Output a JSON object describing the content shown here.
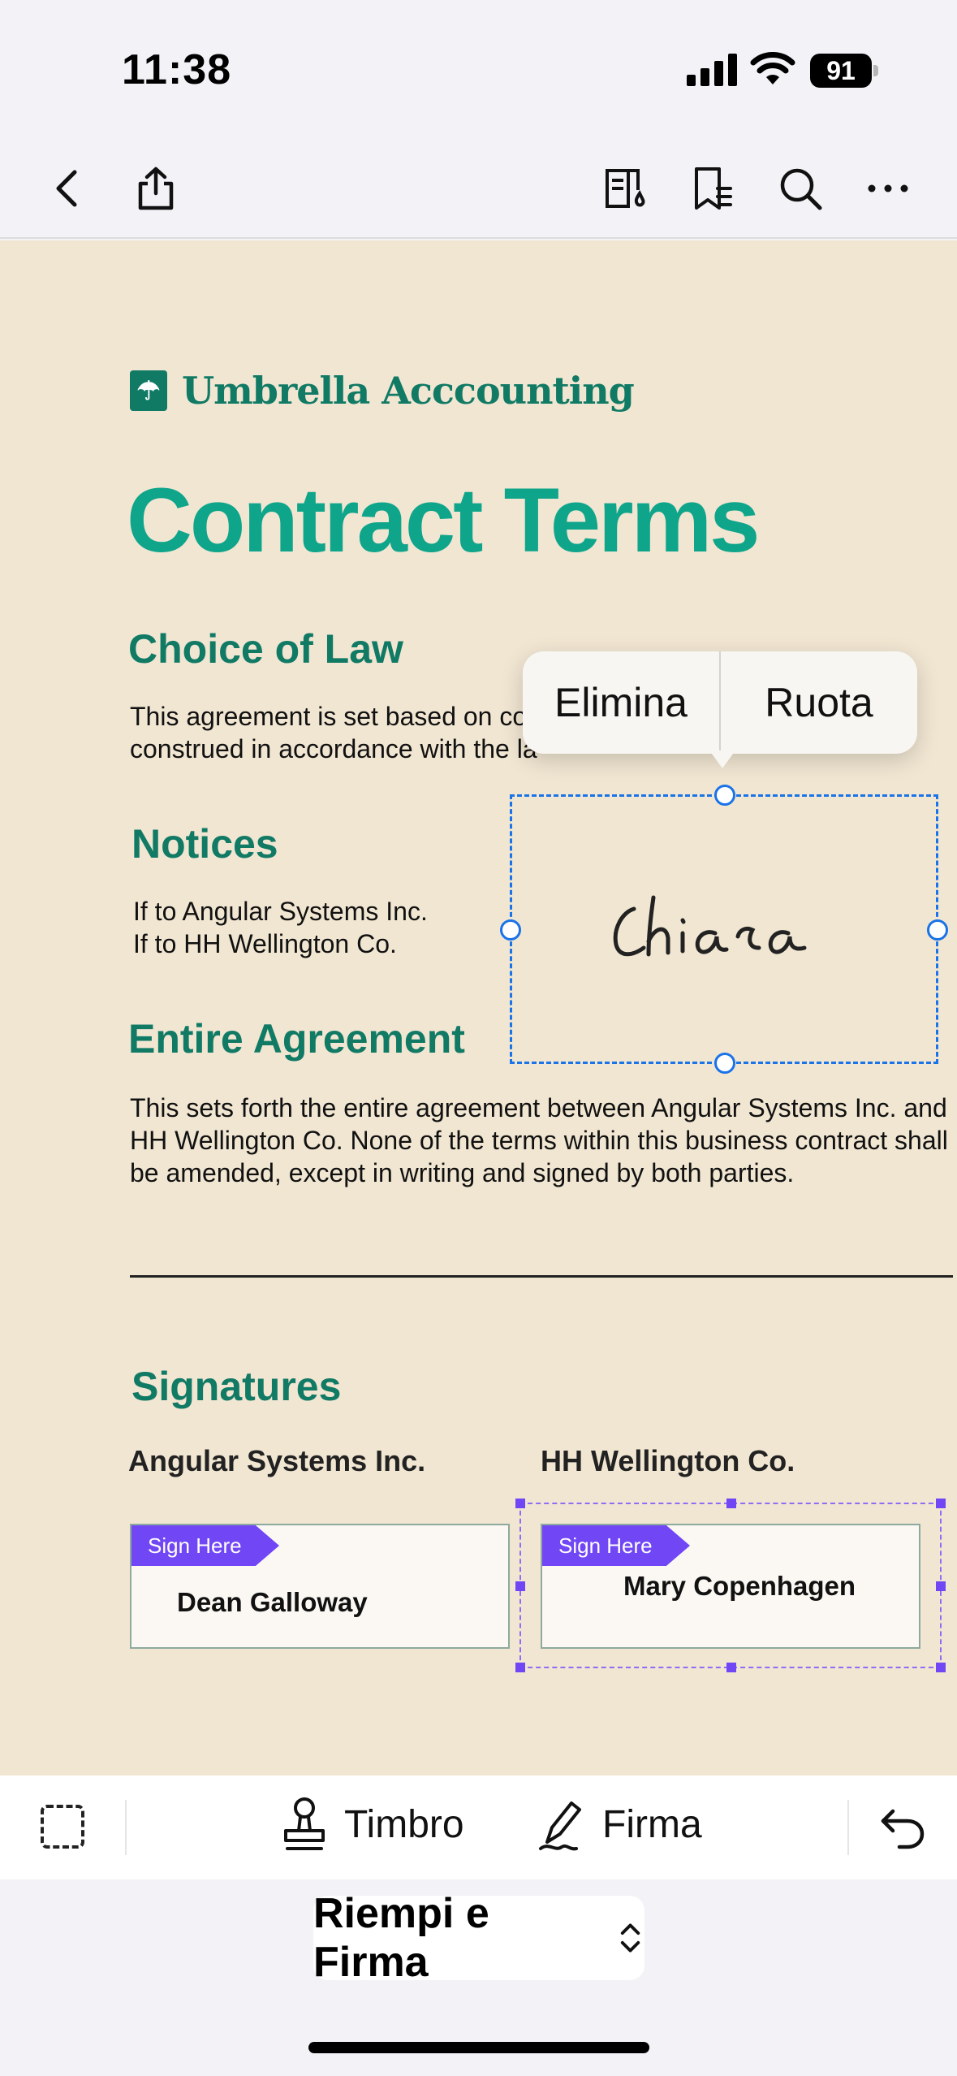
{
  "status_bar": {
    "time": "11:38",
    "battery": "91"
  },
  "toolbar": {
    "back_icon": "chevron-left-icon",
    "share_icon": "share-icon",
    "reader_icon": "book-icon",
    "bookmark_icon": "bookmark-list-icon",
    "search_icon": "search-icon",
    "more_icon": "ellipsis-icon"
  },
  "document": {
    "logo_mark": "☂",
    "logo_text": "Umbrella Acccounting",
    "title": "Contract Terms",
    "choice_of_law": {
      "heading": "Choice of Law",
      "line1": "This agreement is set based on co",
      "line2": "construed in accordance with the la"
    },
    "notices": {
      "heading": "Notices",
      "line1": "If to Angular Systems Inc.",
      "line2": "If to HH Wellington Co."
    },
    "entire_agreement": {
      "heading": "Entire Agreement",
      "line1": "This sets forth the entire agreement between Angular Systems Inc. and",
      "line2": "HH Wellington Co. None of the terms within this business contract shall",
      "line3": "be amended, except in writing and signed by both parties."
    },
    "signatures": {
      "heading": "Signatures",
      "party1": "Angular Systems Inc.",
      "party2": "HH Wellington Co.",
      "sign_here": "Sign Here",
      "name1": "Dean Galloway",
      "name2": "Mary Copenhagen"
    },
    "placed_signature": "Chiara"
  },
  "context_menu": {
    "delete": "Elimina",
    "rotate": "Ruota"
  },
  "tools": {
    "stamp": "Timbro",
    "signature": "Firma"
  },
  "mode_selector": {
    "label": "Riempi e Firma"
  },
  "colors": {
    "accent_teal": "#0fa58b",
    "heading_green": "#117a65",
    "selection_blue": "#1a73e8",
    "tag_purple": "#7146f5",
    "paper": "#f1e6d2"
  }
}
